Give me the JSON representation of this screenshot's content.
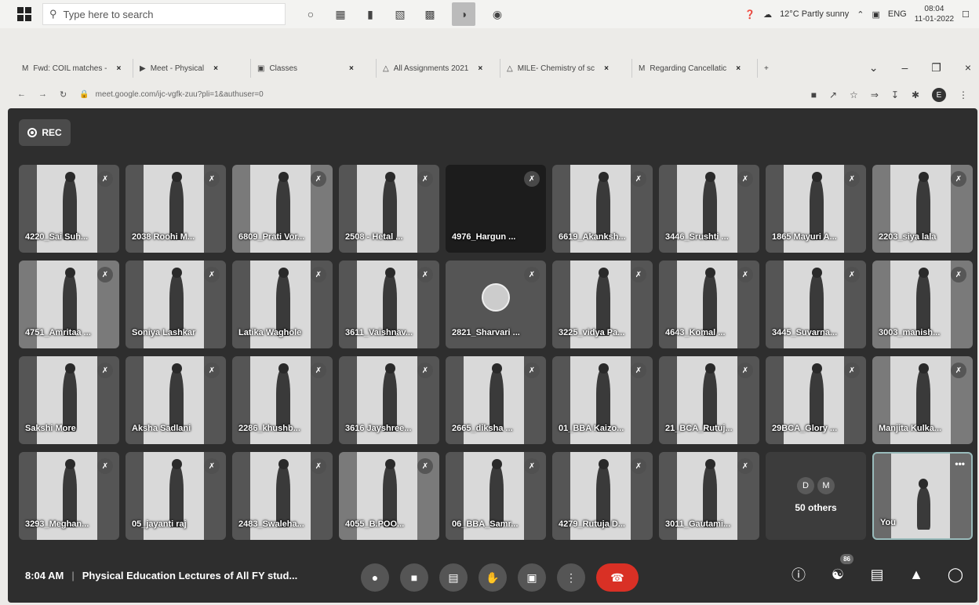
{
  "taskbar": {
    "search_placeholder": "Type here to search",
    "weather": "12°C  Partly sunny",
    "language": "ENG",
    "time": "08:04",
    "date": "11-01-2022"
  },
  "tabs": [
    {
      "label": "Fwd: COIL matches -"
    },
    {
      "label": "Meet - Physical"
    },
    {
      "label": "Classes"
    },
    {
      "label": "All Assignments 2021"
    },
    {
      "label": "MILE- Chemistry of sc"
    },
    {
      "label": "Regarding Cancellatic"
    }
  ],
  "address": {
    "url": "meet.google.com/ijc-vgfk-zuu?pli=1&authuser=0",
    "profile_initial": "E"
  },
  "meet": {
    "rec_label": "REC",
    "participants": [
      "4220_Sai Suh...",
      "2038 Roohi M...",
      "6809_Prati Vor...",
      "2508 - Hetal ...",
      "4976_Hargun ...",
      "6619_Akanksh...",
      "3446_Srushti ...",
      "1865 Mayuri A...",
      "2203_siya lala",
      "4751_Amritaa ...",
      "Soniya Lashkar",
      "Latika Waghole",
      "3611_Vaishnav...",
      "2821_Sharvari ...",
      "3225_vidya Pa...",
      "4643_Komal ...",
      "3445_Suvarna...",
      "3003_manish...",
      "Sakshi More",
      "Aksha Sadlani",
      "2286_khushb...",
      "3616 Jayshree...",
      "2665_diksha ...",
      "01_BBA Kaizo...",
      "21_BCA_Rutuj...",
      "29BCA_Glory ...",
      "Manjita Kulka...",
      "3293_Meghan...",
      "05_jayanti raj",
      "2483_Swaleha...",
      "4055_B.POO...",
      "06_BBA_Samr...",
      "4279_Rutuja D...",
      "3011_Gautami..."
    ],
    "others": {
      "initials": [
        "D",
        "M"
      ],
      "label": "50 others"
    },
    "you_label": "You",
    "time": "8:04 AM",
    "meeting_title": "Physical Education Lectures of All FY stud...",
    "people_count": "86"
  }
}
